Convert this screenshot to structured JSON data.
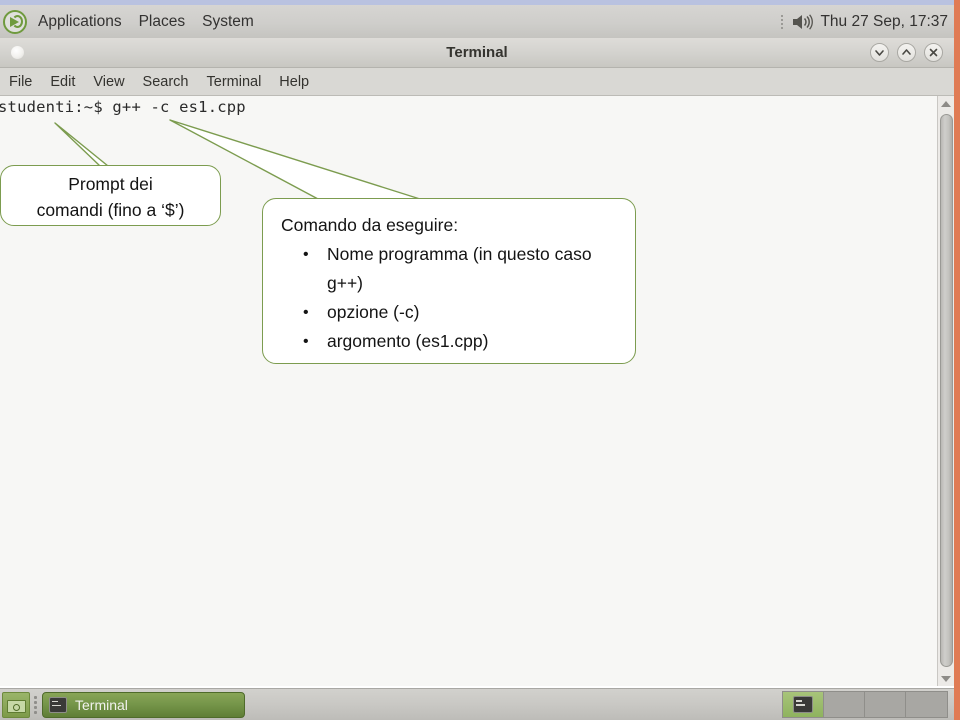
{
  "desktop": {
    "top_panel": {
      "logo_icon": "mint-menu-icon",
      "menus": [
        {
          "label": "Applications",
          "name": "applications-menu"
        },
        {
          "label": "Places",
          "name": "places-menu"
        },
        {
          "label": "System",
          "name": "system-menu"
        }
      ],
      "tray": {
        "volume_icon": "volume-icon",
        "clock": "Thu 27 Sep, 17:37"
      }
    },
    "bottom_panel": {
      "show_desktop_icon": "show-desktop-icon",
      "task_button": {
        "label": "Terminal",
        "icon": "terminal-icon"
      },
      "workspaces": [
        {
          "name": "workspace-1",
          "active": true,
          "icon": "terminal-icon"
        },
        {
          "name": "workspace-2",
          "active": false,
          "icon": ""
        },
        {
          "name": "workspace-3",
          "active": false,
          "icon": ""
        },
        {
          "name": "workspace-4",
          "active": false,
          "icon": ""
        }
      ]
    }
  },
  "terminal": {
    "title": "Terminal",
    "window_buttons": [
      {
        "name": "minimize-button",
        "icon": "chevron-down-icon"
      },
      {
        "name": "maximize-button",
        "icon": "chevron-up-icon"
      },
      {
        "name": "close-button",
        "icon": "close-icon"
      }
    ],
    "menubar": [
      {
        "label": "File",
        "name": "menu-file"
      },
      {
        "label": "Edit",
        "name": "menu-edit"
      },
      {
        "label": "View",
        "name": "menu-view"
      },
      {
        "label": "Search",
        "name": "menu-search"
      },
      {
        "label": "Terminal",
        "name": "menu-terminal"
      },
      {
        "label": "Help",
        "name": "menu-help"
      }
    ],
    "content": {
      "line1": "studenti:~$ g++ -c es1.cpp"
    },
    "scrollbar": {
      "up_arrow": "scroll-up-arrow",
      "down_arrow": "scroll-down-arrow"
    }
  },
  "annotations": {
    "border_color": "#7c9c4f",
    "prompt_callout": {
      "line1": "Prompt dei",
      "line2": "comandi (fino a ‘$’)"
    },
    "command_callout": {
      "title": "Comando da eseguire:",
      "bullets": [
        "Nome programma (in questo caso g++)",
        "opzione (-c)",
        "argomento (es1.cpp)"
      ]
    }
  }
}
